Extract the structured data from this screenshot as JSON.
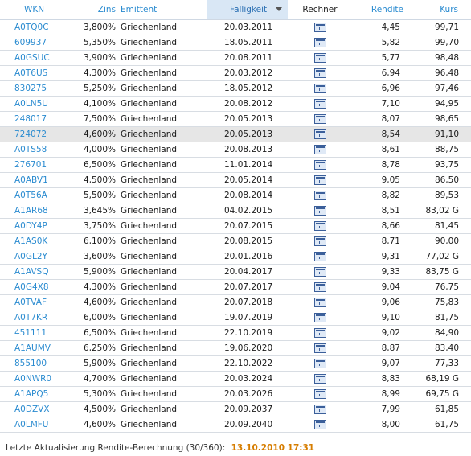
{
  "headers": {
    "wkn": "WKN",
    "zins": "Zins",
    "emittent": "Emittent",
    "faelligkeit": "Fälligkeit",
    "rechner": "Rechner",
    "rendite": "Rendite",
    "kurs": "Kurs"
  },
  "sorted_column": "faelligkeit",
  "highlighted_row": 7,
  "rows": [
    {
      "wkn": "A0TQ0C",
      "zins": "3,800%",
      "emittent": "Griechenland",
      "faelligkeit": "20.03.2011",
      "rendite": "4,45",
      "kurs": "99,71"
    },
    {
      "wkn": "609937",
      "zins": "5,350%",
      "emittent": "Griechenland",
      "faelligkeit": "18.05.2011",
      "rendite": "5,82",
      "kurs": "99,70"
    },
    {
      "wkn": "A0GSUC",
      "zins": "3,900%",
      "emittent": "Griechenland",
      "faelligkeit": "20.08.2011",
      "rendite": "5,77",
      "kurs": "98,48"
    },
    {
      "wkn": "A0T6US",
      "zins": "4,300%",
      "emittent": "Griechenland",
      "faelligkeit": "20.03.2012",
      "rendite": "6,94",
      "kurs": "96,48"
    },
    {
      "wkn": "830275",
      "zins": "5,250%",
      "emittent": "Griechenland",
      "faelligkeit": "18.05.2012",
      "rendite": "6,96",
      "kurs": "97,46"
    },
    {
      "wkn": "A0LN5U",
      "zins": "4,100%",
      "emittent": "Griechenland",
      "faelligkeit": "20.08.2012",
      "rendite": "7,10",
      "kurs": "94,95"
    },
    {
      "wkn": "248017",
      "zins": "7,500%",
      "emittent": "Griechenland",
      "faelligkeit": "20.05.2013",
      "rendite": "8,07",
      "kurs": "98,65"
    },
    {
      "wkn": "724072",
      "zins": "4,600%",
      "emittent": "Griechenland",
      "faelligkeit": "20.05.2013",
      "rendite": "8,54",
      "kurs": "91,10"
    },
    {
      "wkn": "A0TS58",
      "zins": "4,000%",
      "emittent": "Griechenland",
      "faelligkeit": "20.08.2013",
      "rendite": "8,61",
      "kurs": "88,75"
    },
    {
      "wkn": "276701",
      "zins": "6,500%",
      "emittent": "Griechenland",
      "faelligkeit": "11.01.2014",
      "rendite": "8,78",
      "kurs": "93,75"
    },
    {
      "wkn": "A0ABV1",
      "zins": "4,500%",
      "emittent": "Griechenland",
      "faelligkeit": "20.05.2014",
      "rendite": "9,05",
      "kurs": "86,50"
    },
    {
      "wkn": "A0T56A",
      "zins": "5,500%",
      "emittent": "Griechenland",
      "faelligkeit": "20.08.2014",
      "rendite": "8,82",
      "kurs": "89,53"
    },
    {
      "wkn": "A1AR68",
      "zins": "3,645%",
      "emittent": "Griechenland",
      "faelligkeit": "04.02.2015",
      "rendite": "8,51",
      "kurs": "83,02 G"
    },
    {
      "wkn": "A0DY4P",
      "zins": "3,750%",
      "emittent": "Griechenland",
      "faelligkeit": "20.07.2015",
      "rendite": "8,66",
      "kurs": "81,45"
    },
    {
      "wkn": "A1AS0K",
      "zins": "6,100%",
      "emittent": "Griechenland",
      "faelligkeit": "20.08.2015",
      "rendite": "8,71",
      "kurs": "90,00"
    },
    {
      "wkn": "A0GL2Y",
      "zins": "3,600%",
      "emittent": "Griechenland",
      "faelligkeit": "20.01.2016",
      "rendite": "9,31",
      "kurs": "77,02 G"
    },
    {
      "wkn": "A1AVSQ",
      "zins": "5,900%",
      "emittent": "Griechenland",
      "faelligkeit": "20.04.2017",
      "rendite": "9,33",
      "kurs": "83,75 G"
    },
    {
      "wkn": "A0G4X8",
      "zins": "4,300%",
      "emittent": "Griechenland",
      "faelligkeit": "20.07.2017",
      "rendite": "9,04",
      "kurs": "76,75"
    },
    {
      "wkn": "A0TVAF",
      "zins": "4,600%",
      "emittent": "Griechenland",
      "faelligkeit": "20.07.2018",
      "rendite": "9,06",
      "kurs": "75,83"
    },
    {
      "wkn": "A0T7KR",
      "zins": "6,000%",
      "emittent": "Griechenland",
      "faelligkeit": "19.07.2019",
      "rendite": "9,10",
      "kurs": "81,75"
    },
    {
      "wkn": "451111",
      "zins": "6,500%",
      "emittent": "Griechenland",
      "faelligkeit": "22.10.2019",
      "rendite": "9,02",
      "kurs": "84,90"
    },
    {
      "wkn": "A1AUMV",
      "zins": "6,250%",
      "emittent": "Griechenland",
      "faelligkeit": "19.06.2020",
      "rendite": "8,87",
      "kurs": "83,40"
    },
    {
      "wkn": "855100",
      "zins": "5,900%",
      "emittent": "Griechenland",
      "faelligkeit": "22.10.2022",
      "rendite": "9,07",
      "kurs": "77,33"
    },
    {
      "wkn": "A0NWR0",
      "zins": "4,700%",
      "emittent": "Griechenland",
      "faelligkeit": "20.03.2024",
      "rendite": "8,83",
      "kurs": "68,19 G"
    },
    {
      "wkn": "A1APQ5",
      "zins": "5,300%",
      "emittent": "Griechenland",
      "faelligkeit": "20.03.2026",
      "rendite": "8,99",
      "kurs": "69,75 G"
    },
    {
      "wkn": "A0DZVX",
      "zins": "4,500%",
      "emittent": "Griechenland",
      "faelligkeit": "20.09.2037",
      "rendite": "7,99",
      "kurs": "61,85"
    },
    {
      "wkn": "A0LMFU",
      "zins": "4,600%",
      "emittent": "Griechenland",
      "faelligkeit": "20.09.2040",
      "rendite": "8,00",
      "kurs": "61,75"
    }
  ],
  "footer": {
    "label": "Letzte Aktualisierung Rendite-Berechnung (30/360):",
    "timestamp": "13.10.2010 17:31"
  },
  "colors": {
    "link": "#2a8bd0",
    "sorted_header_bg": "#d9e7f5",
    "highlight_row_bg": "#e6e6e6",
    "timestamp": "#d67d00"
  },
  "icons": {
    "rechner": "calculator-icon",
    "sort": "sort-descending-icon"
  }
}
